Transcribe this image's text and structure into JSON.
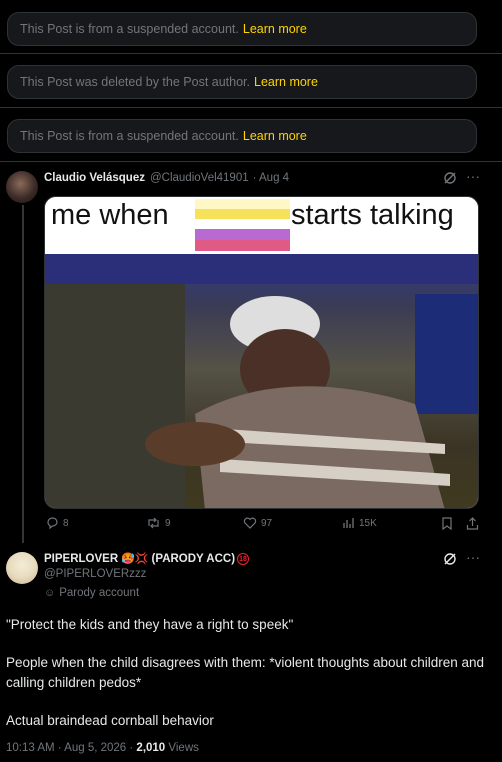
{
  "notices": [
    {
      "text": "This Post is from a suspended account.",
      "link": "Learn more"
    },
    {
      "text": "This Post was deleted by the Post author.",
      "link": "Learn more"
    },
    {
      "text": "This Post is from a suspended account.",
      "link": "Learn more"
    }
  ],
  "reply_post": {
    "author": "Claudio Velásquez",
    "handle": "@ClaudioVel41901",
    "time": "· Aug 4",
    "meme_left": "me when",
    "meme_right": "starts talking",
    "replies": "8",
    "reposts": "9",
    "likes": "97",
    "views": "15K"
  },
  "main_post": {
    "author": "PIPERLOVER",
    "author_suffix": "(PARODY ACC)",
    "emoji_a": "🥵",
    "emoji_b": "💢",
    "age_badge": "18",
    "handle": "@PIPERLOVERzzz",
    "parody_label": "Parody account",
    "line1": "\"Protect the kids and they have a right to speek\"",
    "line2": "People when the child disagrees with them: *violent thoughts about children and calling children pedos*",
    "line3": "Actual braindead cornball behavior",
    "timestamp": "10:13 AM · Aug 5, 2026 · ",
    "views_count": "2,010",
    "views_label": "Views"
  },
  "colors": {
    "accent": "#ffd400",
    "muted": "#71767b",
    "border": "#2f3336"
  }
}
